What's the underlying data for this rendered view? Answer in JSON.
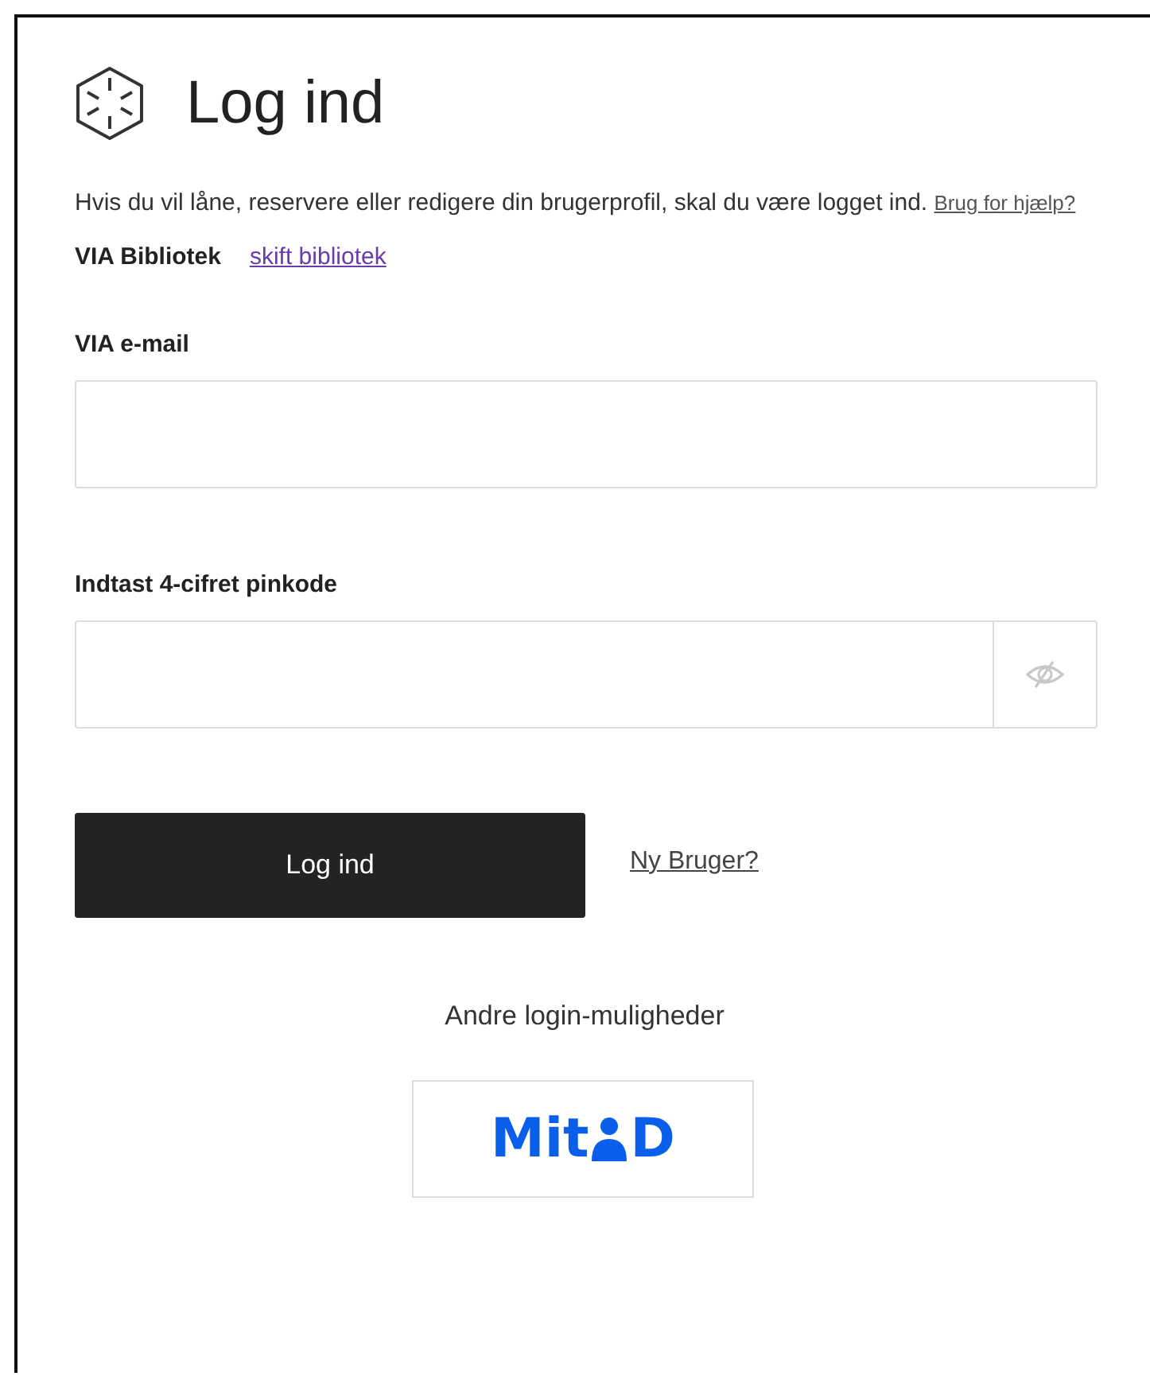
{
  "title": "Log ind",
  "intro": {
    "text": "Hvis du vil låne, reservere eller redigere din brugerprofil, skal du være logget ind.",
    "help_link": "Brug for hjælp?"
  },
  "library": {
    "name": "VIA Bibliotek",
    "change_link": "skift bibliotek"
  },
  "fields": [
    {
      "label": "VIA e-mail",
      "kind": "text"
    },
    {
      "label": "Indtast 4-cifret pinkode",
      "kind": "password"
    }
  ],
  "login_button": "Log ind",
  "new_user_link": "Ny Bruger?",
  "other_logins": {
    "heading": "Andre login-muligheder",
    "mitid": {
      "prefix": "Mit",
      "suffix": "D"
    }
  }
}
